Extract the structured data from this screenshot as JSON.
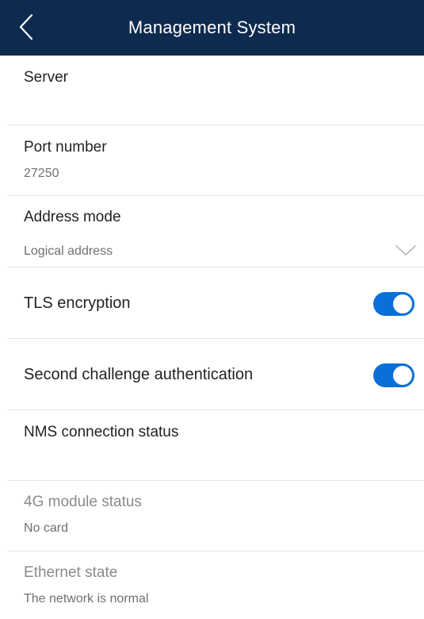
{
  "header": {
    "title": "Management System",
    "back_icon": "chevron-left-icon"
  },
  "settings": {
    "server": {
      "label": "Server",
      "value": ""
    },
    "port_number": {
      "label": "Port number",
      "value": "27250"
    },
    "address_mode": {
      "label": "Address mode",
      "value": "Logical address",
      "icon": "chevron-down-icon"
    },
    "tls_encryption": {
      "label": "TLS encryption",
      "enabled": true
    },
    "second_challenge_authentication": {
      "label": "Second challenge authentication",
      "enabled": true
    },
    "nms_connection_status": {
      "label": "NMS connection status",
      "value": ""
    },
    "module_4g_status": {
      "label": "4G module status",
      "value": "No card"
    },
    "ethernet_state": {
      "label": "Ethernet state",
      "value": "The network is normal"
    }
  },
  "colors": {
    "header_bg": "#0f2a4f",
    "toggle_on": "#0a6fd8",
    "divider": "#e6e6e6"
  }
}
